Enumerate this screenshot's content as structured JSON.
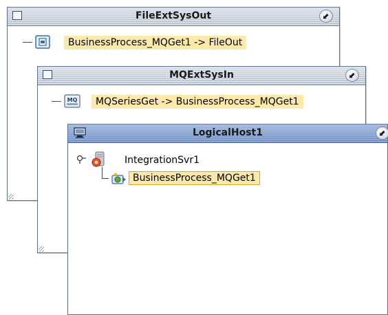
{
  "windows": {
    "file_ext": {
      "title": "FileExtSysOut",
      "minimize_glyph": "⬋",
      "item_label": "BusinessProcess_MQGet1 -> FileOut",
      "item_icon": "file-connector-icon"
    },
    "mq_ext": {
      "title": "MQExtSysIn",
      "minimize_glyph": "⬋",
      "item_label": "MQSeriesGet -> BusinessProcess_MQGet1",
      "item_icon_text": "MQ",
      "item_icon": "mq-series-icon"
    },
    "logical_host": {
      "title": "LogicalHost1",
      "minimize_glyph": "⬋",
      "server_label": "IntegrationSvr1",
      "process_label": "BusinessProcess_MQGet1"
    }
  },
  "colors": {
    "highlight": "#fde9a9",
    "active_title": "#6e8fc7",
    "inactive_title": "#b9c3d1",
    "border": "#5d6f8a"
  }
}
